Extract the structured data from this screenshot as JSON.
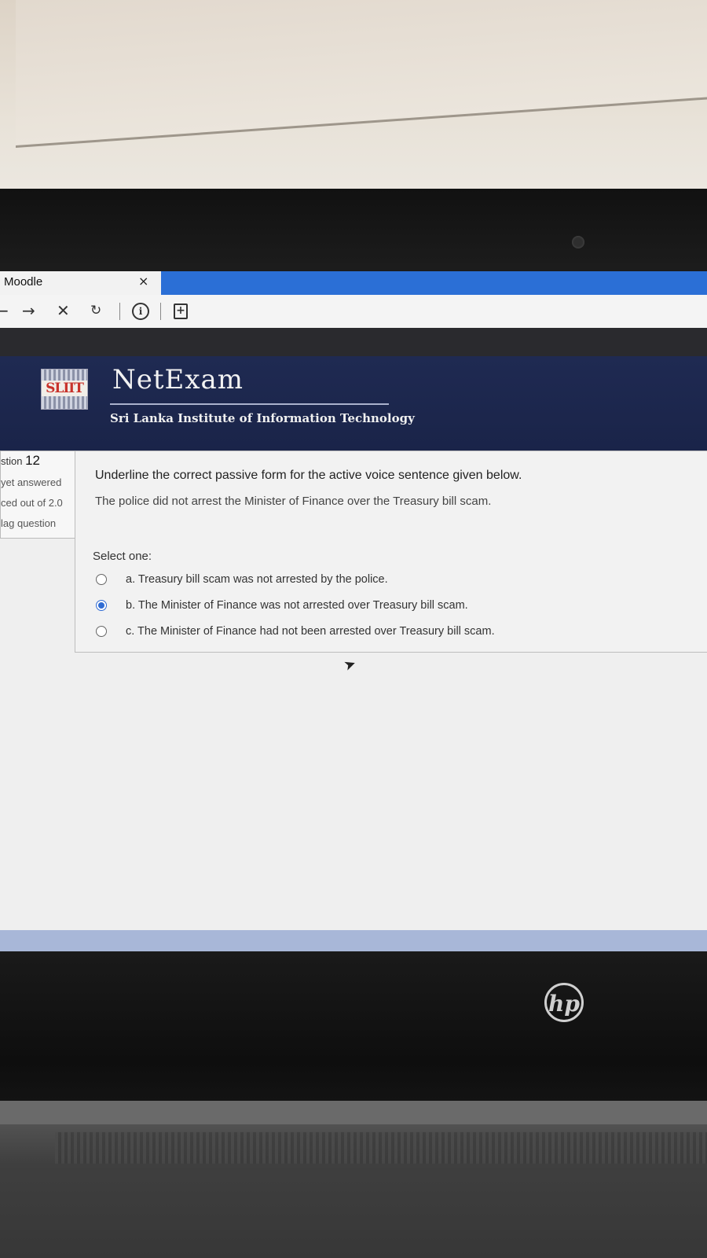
{
  "browser": {
    "tab_title": "Moodle",
    "tab_close": "×",
    "back": "←",
    "forward": "→",
    "stop": "✕",
    "reload": "↻",
    "info": "i",
    "new_tab": "+"
  },
  "header": {
    "logo_text": "SLIIT",
    "title": "NetExam",
    "subtitle": "Sri Lanka Institute of Information Technology"
  },
  "question_info": {
    "number_prefix": "stion",
    "number": "12",
    "state": "yet answered",
    "grade": "ced out of 2.0",
    "flag": "lag question"
  },
  "question": {
    "prompt": "Underline the correct passive form for the active voice sentence given below.",
    "sentence": "The police did not arrest the Minister of Finance over the Treasury bill scam.",
    "select_label": "Select one:",
    "options": [
      {
        "label": "a. Treasury bill scam was not arrested by the police.",
        "selected": false
      },
      {
        "label": "b. The Minister of Finance was not arrested over Treasury bill scam.",
        "selected": true
      },
      {
        "label": "c. The Minister of Finance had not been arrested over Treasury bill scam.",
        "selected": false
      }
    ]
  },
  "device": {
    "brand": "hp"
  },
  "colors": {
    "tab_bar": "#2b6fd6",
    "header_bg": "#1f2a52",
    "header_accent": "#e1663a",
    "radio_selected": "#2f6bd3"
  }
}
